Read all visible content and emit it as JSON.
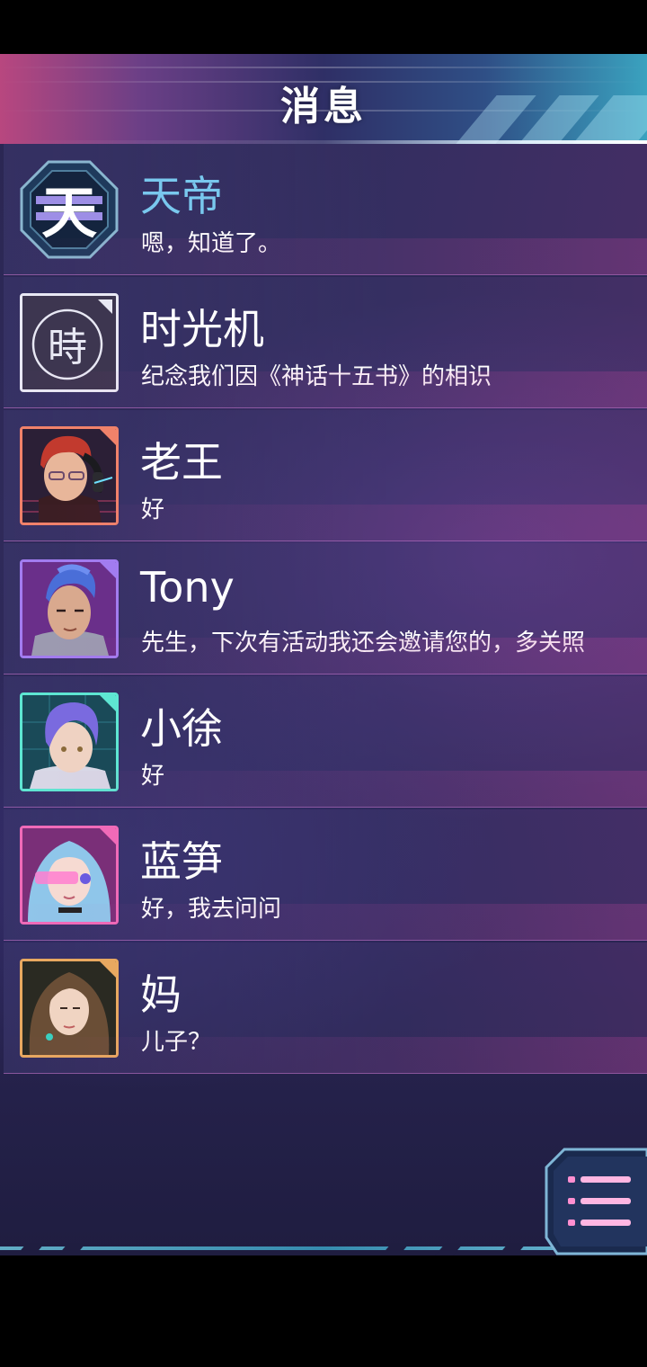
{
  "header": {
    "title": "消息"
  },
  "conversations": [
    {
      "name": "天帝",
      "message": "嗯，知道了。",
      "avatar": "tian-octagon-logo",
      "frame_color": "#8ab6cf",
      "name_color": "#79c8ee",
      "badge_char": "天"
    },
    {
      "name": "时光机",
      "message": "纪念我们因《神话十五书》的相识",
      "avatar": "time-machine-logo",
      "frame_color": "#e8e8f4",
      "badge_char": "時"
    },
    {
      "name": "老王",
      "message": "好",
      "avatar": "red-hair-man-with-headset",
      "frame_color": "#f0826a"
    },
    {
      "name": "Tony",
      "message": "先生，下次有活动我还会邀请您的，多关照",
      "avatar": "blue-mohawk-man",
      "frame_color": "#a27cf0"
    },
    {
      "name": "小徐",
      "message": "好",
      "avatar": "purple-hair-boy",
      "frame_color": "#5ee6d2"
    },
    {
      "name": "蓝笋",
      "message": "好，我去问问",
      "avatar": "blue-hair-girl-with-visor",
      "frame_color": "#f06ab8"
    },
    {
      "name": "妈",
      "message": "儿子？",
      "avatar": "brown-hair-woman",
      "frame_color": "#e8a860"
    }
  ],
  "menu_button": {
    "icon": "menu-list-icon",
    "accent": "#ff8fd0"
  }
}
